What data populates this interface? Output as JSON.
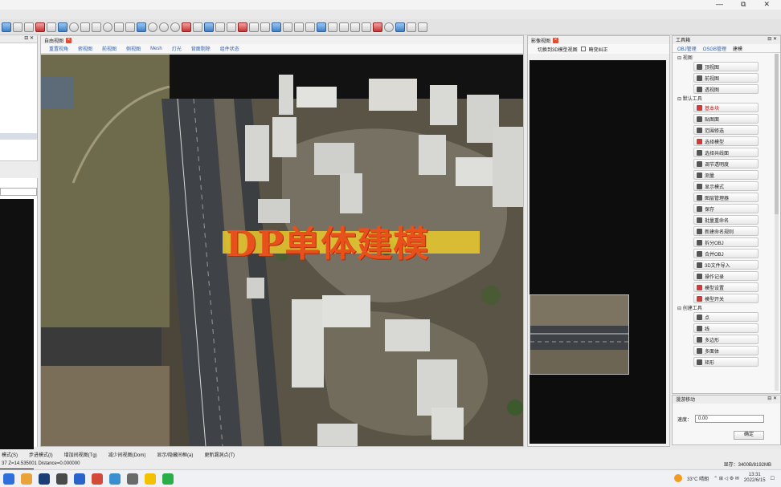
{
  "window": {
    "min": "—",
    "max": "⧉",
    "close": "✕"
  },
  "free_view": {
    "title": "自由视图",
    "tabs": [
      "重置视角",
      "俯视图",
      "前视图",
      "侧视图",
      "Mesh",
      "灯光",
      "背面剔除",
      "组件状态"
    ]
  },
  "overlay_title": "DP单体建模",
  "image_view": {
    "title": "影像视图",
    "option1": "切换到3D模型视图",
    "option2": "畸变纠正"
  },
  "toolbox": {
    "title": "工具箱",
    "tabs": [
      "OBJ管理",
      "OSGB管理",
      "建模"
    ],
    "groups": [
      {
        "name": "视图",
        "items": [
          "顶视图",
          "前视图",
          "透视图"
        ]
      },
      {
        "name": "默认工具",
        "items": [
          "基本块",
          "贴图面",
          "范围修选",
          "选择模型",
          "选择共线面",
          "调节透明度",
          "测量",
          "显示模式",
          "图层管理器",
          "保存",
          "批量重命名",
          "新建命名规则",
          "拆分OBJ",
          "合并OBJ",
          "3D文件导入",
          "操作记录",
          "模型设置",
          "模型开关"
        ]
      },
      {
        "name": "创建工具",
        "items": [
          "点",
          "线",
          "多边形",
          "多面体",
          "矩形"
        ]
      }
    ]
  },
  "roam": {
    "title": "漫游移动",
    "speed_label": "速度：",
    "speed_value": "0.00",
    "confirm": "确定"
  },
  "status": {
    "items": [
      "模式(S)",
      "步进模式(I)",
      "增加间视图(Tg)",
      "减少间视图(Dom)",
      "显示/隐藏间框(a)",
      "更新漏洞点(T)"
    ],
    "coords": "37  Z=14.535001  Distance=0.000000",
    "display": "显存：3400B/8192MB"
  },
  "taskbar": {
    "weather": "33°C  晴朗",
    "time": "13:31",
    "date": "2022/6/15"
  }
}
